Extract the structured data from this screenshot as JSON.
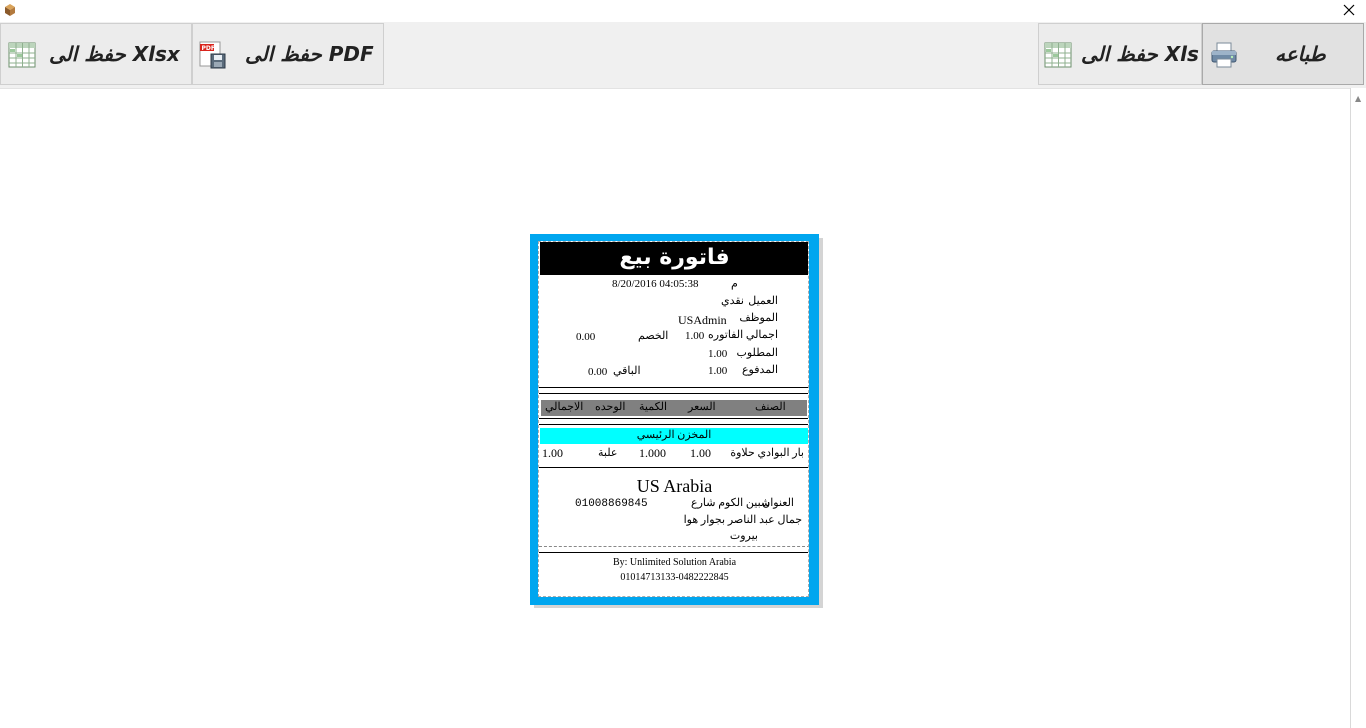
{
  "toolbar": {
    "print_label": "طباعه",
    "xls_label": "حفظ الى Xls",
    "pdf_label": "حفظ الى PDF",
    "xlsx_label": "حفظ الى Xlsx"
  },
  "receipt": {
    "title": "فاتورة بيع",
    "datetime": "8/20/2016 04:05:38",
    "period": "م",
    "customer_label": "العميل",
    "customer_value": "نقدي",
    "employee_label": "الموظف",
    "employee_value": "USAdmin",
    "total_label": "اجمالي الفاتوره",
    "total_value": "1.00",
    "discount_label": "الخصم",
    "discount_value": "0.00",
    "required_label": "المطلوب",
    "required_value": "1.00",
    "paid_label": "المدفوع",
    "paid_value": "1.00",
    "remaining_label": "الباقي",
    "remaining_value": "0.00",
    "columns": {
      "item": "الصنف",
      "price": "السعر",
      "qty": "الكمية",
      "unit": "الوحده",
      "total": "الاجمالي"
    },
    "warehouse": "المخزن الرئيسي",
    "row": {
      "item": "بار البوادي حلاوة",
      "price": "1.00",
      "qty": "1.000",
      "unit": "علبة",
      "total": "1.00"
    },
    "company": "US Arabia",
    "address_label": "العنوان",
    "address_line1": "شبين الكوم شارع",
    "address_line2": "جمال عبد الناصر بجوار هوا",
    "address_line3": "بيروت",
    "phone": "01008869845",
    "footer_by": "By: Unlimited Solution Arabia",
    "footer_phones": "01014713133-0482222845"
  }
}
